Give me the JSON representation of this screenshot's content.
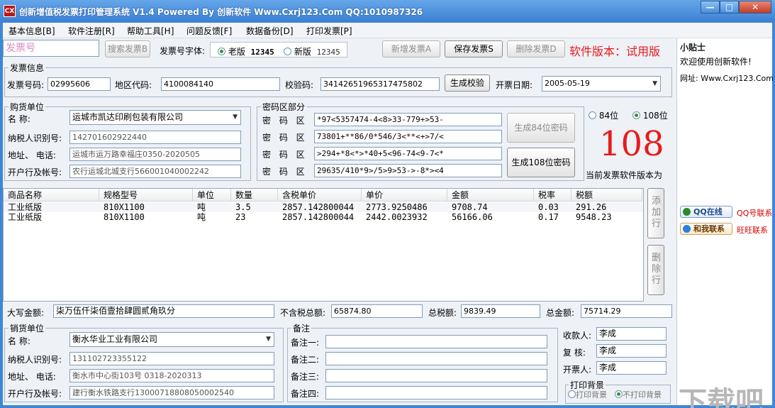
{
  "window": {
    "app_icon": "CX",
    "title": "创新增值税发票打印管理系统 V1.4 Powered By 创新软件 Www.Cxrj123.Com QQ:1010987326",
    "min": "—",
    "max": "□",
    "close": "✕"
  },
  "menu": [
    "基本信息[B]",
    "软件注册[R]",
    "帮助工具[H]",
    "问题反馈[F]",
    "数据备份[D]",
    "打印发票[P]"
  ],
  "toolbar": {
    "search_placeholder": "发票号",
    "search_button": "搜索发票B",
    "font_label": "发票号字体:",
    "font_old_label": "老版",
    "font_old_sample": "12345",
    "font_new_label": "新版",
    "font_new_sample": "12345",
    "new_button": "新增发票A",
    "save_button": "保存发票S",
    "delete_button": "删除发票D",
    "version_text": "软件版本：试用版"
  },
  "invoice": {
    "group": "发票信息",
    "number_label": "发票号码:",
    "number": "02995606",
    "area_label": "地区代码:",
    "area": "4100084140",
    "check_label": "校验码:",
    "check": "34142651965317475802",
    "gen_check_button": "生成校验",
    "date_label": "开票日期:",
    "date": "2005-05-19"
  },
  "buyer": {
    "group": "购货单位",
    "name_label": "名    称:",
    "name": "运城市凯达印刷包装有限公司",
    "tax_label": "纳税人识别号:",
    "tax": "142701602922440",
    "addr_label": "地址、 电话:",
    "addr": "运城市运万路幸福庄0350-2020505",
    "bank_label": "开户行及帐号:",
    "bank": "农行运城北城支行566001040002242"
  },
  "cipher": {
    "group": "密码区部分",
    "row_label": "密 码 区",
    "rows": [
      "*97<5357474-4<8>33-779+>53-",
      "73801+**86/0*546/3<**<+>7/<",
      ">294+*8<*>*40+5<96-74<9-7<*",
      "29635/410*9>/5>9>53->-8*><4"
    ],
    "gen84_button": "生成84位密码",
    "gen108_button": "生成108位密码",
    "opt84": "84位",
    "opt108": "108位",
    "version_number": "108",
    "version_caption": "当前发票软件版本为"
  },
  "table": {
    "headers": [
      "商品名称",
      "规格型号",
      "单位",
      "数量",
      "含税单价",
      "单价",
      "金额",
      "税率",
      "税额"
    ],
    "rows": [
      [
        "工业纸版",
        "810X1100",
        "吨",
        "3.5",
        "2857.142800044",
        "2773.9250486",
        "9708.74",
        "0.03",
        "291.26"
      ],
      [
        "工业纸版",
        "810X1100",
        "吨",
        "23",
        "2857.142800044",
        "2442.0023932",
        "56166.06",
        "0.17",
        "9548.23"
      ]
    ],
    "add_row": "添加行",
    "del_row": "删除行"
  },
  "totals": {
    "caps_label": "大写金额:",
    "caps": "柒万伍仟柒佰壹拾肆圆贰角玖分",
    "pretax_label": "不含税总额:",
    "pretax": "65874.80",
    "tax_label": "总税额:",
    "tax": "9839.49",
    "total_label": "总金额:",
    "total": "75714.29"
  },
  "seller": {
    "group": "销货单位",
    "name_label": "名    称:",
    "name": "衡水华业工业有限公司",
    "tax_label": "纳税人识别号:",
    "tax": "131102723355122",
    "addr_label": "地址、 电话:",
    "addr": "衡水市中心街103号 0318-2020313",
    "bank_label": "开户行及帐号:",
    "bank": "建行衡水铁路支行13000718808050002540"
  },
  "notes": {
    "group": "备注",
    "labels": [
      "备注一:",
      "备注二:",
      "备注三:",
      "备注四:"
    ]
  },
  "people": {
    "payee_label": "收款人:",
    "payee": "李成",
    "review_label": "复  核:",
    "review": "李成",
    "issuer_label": "开票人:",
    "issuer": "李成",
    "print_bg_group": "打印背景",
    "print_bg": "打印背景",
    "no_print_bg": "不打印背景"
  },
  "tips": {
    "title": "小贴士",
    "welcome": "欢迎使用创新软件!",
    "site": "网址: Www.Cxrj123.Com",
    "qq_badge": "QQ在线",
    "qq_link": "QQ号联系",
    "ww_badge": "和我联系",
    "ww_link": "旺旺联系"
  },
  "watermark": "下载吧",
  "colors": {
    "title_bar": "#3a80d2",
    "red_text": "#e81b1b",
    "accent_link": "#d60000"
  }
}
